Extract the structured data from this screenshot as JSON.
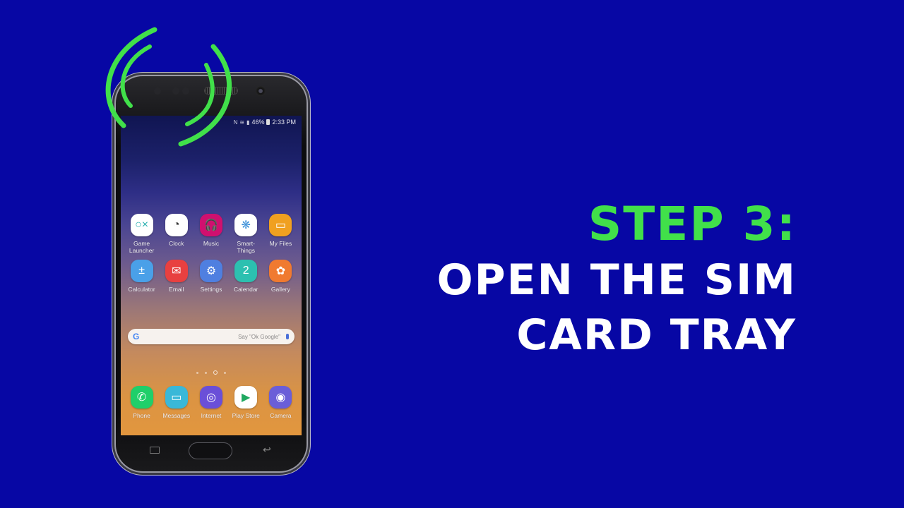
{
  "headline": {
    "step": "STEP 3:",
    "line1": "OPEN THE SIM",
    "line2": "CARD TRAY",
    "step_color": "#41e04a",
    "text_color": "#ffffff",
    "background_color": "#0707a4"
  },
  "phone": {
    "status_bar": {
      "nfc_icon": "N",
      "wifi_icon": "wifi-icon",
      "signal_icon": "signal-icon",
      "battery": "46%",
      "time": "2:33 PM"
    },
    "apps": [
      {
        "label": "Game\nLauncher",
        "icon": "game-launcher-icon",
        "glyph": "○×",
        "bg": "#ffffff",
        "fg": "#2ab0b0"
      },
      {
        "label": "Clock",
        "icon": "clock-icon",
        "glyph": "◔",
        "bg": "#ffffff",
        "fg": "#333333"
      },
      {
        "label": "Music",
        "icon": "headphones-icon",
        "glyph": "🎧",
        "bg": "#d0106f",
        "fg": "#ffffff"
      },
      {
        "label": "Smart-\nThings",
        "icon": "smartthings-icon",
        "glyph": "❋",
        "bg": "#ffffff",
        "fg": "#3a8fd8"
      },
      {
        "label": "My Files",
        "icon": "folder-icon",
        "glyph": "▭",
        "bg": "#f0a020",
        "fg": "#ffffff"
      },
      {
        "label": "Calculator",
        "icon": "calculator-icon",
        "glyph": "±",
        "bg": "#4aa0e8",
        "fg": "#ffffff"
      },
      {
        "label": "Email",
        "icon": "envelope-icon",
        "glyph": "✉",
        "bg": "#e84040",
        "fg": "#ffffff"
      },
      {
        "label": "Settings",
        "icon": "gear-icon",
        "glyph": "⚙",
        "bg": "#4f7fe0",
        "fg": "#ffffff"
      },
      {
        "label": "Calendar",
        "icon": "calendar-icon",
        "glyph": "2",
        "bg": "#2cc0b0",
        "fg": "#ffffff"
      },
      {
        "label": "Gallery",
        "icon": "flower-icon",
        "glyph": "✿",
        "bg": "#f07a30",
        "fg": "#ffffff"
      }
    ],
    "search": {
      "logo": "G",
      "placeholder": "Say \"Ok Google\"",
      "mic_icon": "microphone-icon"
    },
    "page_indicator": {
      "pages": 3,
      "active": 2
    },
    "dock": [
      {
        "label": "Phone",
        "icon": "phone-icon",
        "glyph": "✆",
        "bg": "#1fcf6a",
        "fg": "#ffffff"
      },
      {
        "label": "Messages",
        "icon": "message-icon",
        "glyph": "▭",
        "bg": "#3ab8d8",
        "fg": "#ffffff"
      },
      {
        "label": "Internet",
        "icon": "planet-icon",
        "glyph": "◎",
        "bg": "#6a4fd8",
        "fg": "#ffffff"
      },
      {
        "label": "Play Store",
        "icon": "play-store-icon",
        "glyph": "▶",
        "bg": "#ffffff",
        "fg": "#1fa860"
      },
      {
        "label": "Camera",
        "icon": "camera-icon",
        "glyph": "◉",
        "bg": "#6a5ed8",
        "fg": "#ffffff"
      }
    ],
    "navbar": {
      "recent": "recent-apps-icon",
      "home": "home-button",
      "back_glyph": "↩"
    }
  },
  "signal_waves_color": "#41e04a"
}
